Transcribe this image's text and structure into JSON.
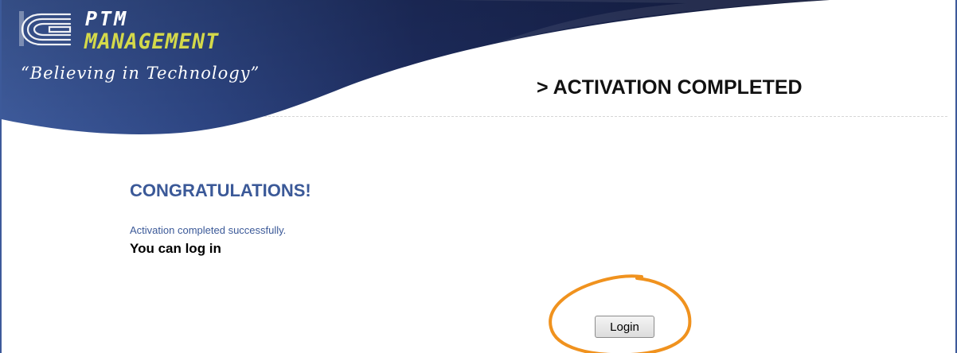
{
  "header": {
    "brand_top": "PTM",
    "brand_bottom": "MANAGEMENT",
    "tagline": "“Believing in Technology”",
    "page_title": "> ACTIVATION COMPLETED",
    "logo_icon": "ptm-logo-icon"
  },
  "content": {
    "heading": "CONGRATULATIONS!",
    "success_message": "Activation completed successfully.",
    "login_prompt": "You can log in",
    "login_button_label": "Login"
  },
  "colors": {
    "header_dark_blue": "#1f2c5e",
    "header_mid_blue": "#3d5a9a",
    "brand_yellow": "#d4d94a",
    "heading_blue": "#3b5998",
    "annotation_orange": "#f0921e"
  }
}
